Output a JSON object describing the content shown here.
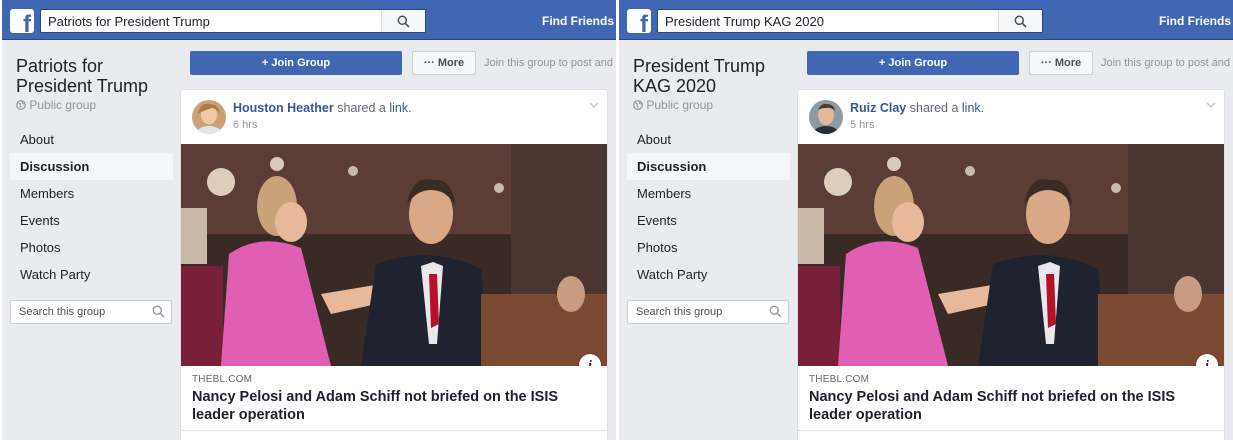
{
  "colors": {
    "brand": "#4267b2",
    "link": "#365899",
    "background": "#e9ebee"
  },
  "panels": [
    {
      "topbar": {
        "logo": "f",
        "search_value": "Patriots for President Trump",
        "search_icon": "search-icon",
        "find_friends": "Find Friends"
      },
      "group": {
        "title": "Patriots for President Trump",
        "privacy": "Public group",
        "privacy_icon": "globe-icon",
        "nav": [
          "About",
          "Discussion",
          "Members",
          "Events",
          "Photos",
          "Watch Party"
        ],
        "active_nav": "Discussion",
        "search_placeholder": "Search this group"
      },
      "actions": {
        "join_label": "+ Join Group",
        "more_label": "··· More",
        "join_hint": "Join this group to post and comment"
      },
      "post": {
        "author": "Houston Heather",
        "shared_text": "shared a",
        "link_word": "link.",
        "time": "6 hrs",
        "info_label": "i",
        "link_domain": "THEBL.COM",
        "link_title": "Nancy Pelosi and Adam Schiff not briefed on the ISIS leader operation"
      }
    },
    {
      "topbar": {
        "logo": "f",
        "search_value": "President Trump KAG 2020",
        "search_icon": "search-icon",
        "find_friends": "Find Friends"
      },
      "group": {
        "title": "President Trump KAG 2020",
        "privacy": "Public group",
        "privacy_icon": "globe-icon",
        "nav": [
          "About",
          "Discussion",
          "Members",
          "Events",
          "Photos",
          "Watch Party"
        ],
        "active_nav": "Discussion",
        "search_placeholder": "Search this group"
      },
      "actions": {
        "join_label": "+ Join Group",
        "more_label": "··· More",
        "join_hint": "Join this group to post and comment"
      },
      "post": {
        "author": "Ruiz Clay",
        "shared_text": "shared a",
        "link_word": "link.",
        "time": "5 hrs",
        "info_label": "i",
        "link_domain": "THEBL.COM",
        "link_title": "Nancy Pelosi and Adam Schiff not briefed on the ISIS leader operation"
      }
    }
  ]
}
